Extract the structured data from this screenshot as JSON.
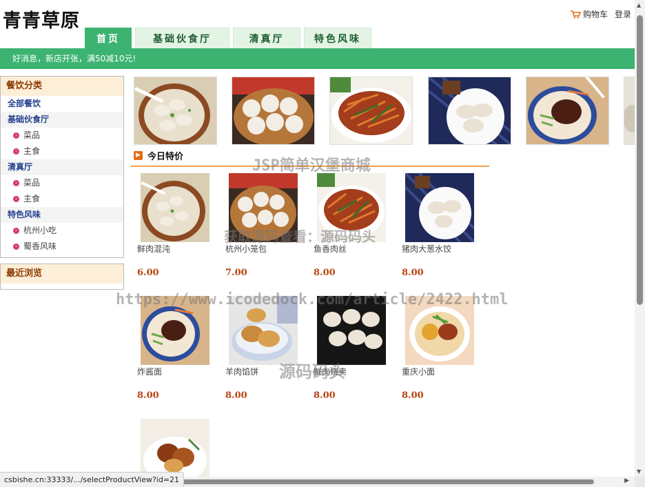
{
  "header": {
    "logo": "青青草原",
    "cart_label": "购物车",
    "login_label": "登录"
  },
  "nav": {
    "tabs": [
      {
        "label": "首页",
        "active": true
      },
      {
        "label": "基础伙食厅",
        "active": false
      },
      {
        "label": "清真厅",
        "active": false
      },
      {
        "label": "特色风味",
        "active": false
      }
    ]
  },
  "banner": {
    "text": "好消息，新店开张，满50减10元!"
  },
  "sidebar": {
    "title": "餐饮分类",
    "all_label": "全部餐饮",
    "groups": [
      {
        "label": "基础伙食厅",
        "items": [
          "菜品",
          "主食"
        ]
      },
      {
        "label": "清真厅",
        "items": [
          "菜品",
          "主食"
        ]
      },
      {
        "label": "特色风味",
        "items": [
          "杭州小吃",
          "蜀香风味"
        ]
      }
    ],
    "recent_title": "最近浏览"
  },
  "section": {
    "title": "今日特价"
  },
  "products": [
    {
      "name": "鲜肉混沌",
      "price": "6.00"
    },
    {
      "name": "杭州小笼包",
      "price": "7.00"
    },
    {
      "name": "鱼香肉丝",
      "price": "8.00"
    },
    {
      "name": "猪肉大葱水饺",
      "price": "8.00"
    },
    {
      "name": "炸酱面",
      "price": "8.00"
    },
    {
      "name": "羊肉馅饼",
      "price": "8.00"
    },
    {
      "name": "鲜肉烧卖",
      "price": "8.00"
    },
    {
      "name": "重庆小面",
      "price": "8.00"
    }
  ],
  "watermarks": [
    "JSP简单汉堡商城",
    "获取源码查看：源码码头",
    "https://www.icodedock.com/article/2422.html",
    "源码码头"
  ],
  "status_url": "csbishe.cn:33333/.../selectProductView?id=21",
  "colors": {
    "accent_green": "#3cb371",
    "price_red": "#b7420f",
    "side_head_bg": "#fdeed8"
  }
}
